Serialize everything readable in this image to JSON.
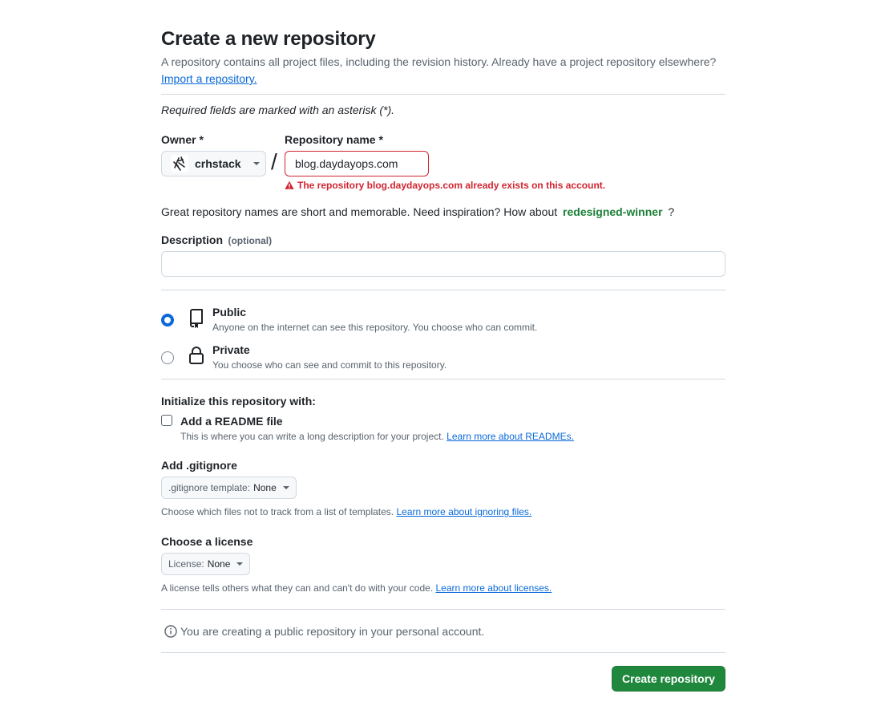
{
  "header": {
    "title": "Create a new repository",
    "desc_prefix": "A repository contains all project files, including the revision history. Already have a project repository elsewhere?",
    "import_link": "Import a repository."
  },
  "required_note": "Required fields are marked with an asterisk (*).",
  "owner": {
    "label": "Owner *",
    "value": "crhstack"
  },
  "separator": "/",
  "repo_name": {
    "label": "Repository name *",
    "value": "blog.daydayops.com",
    "error": "The repository blog.daydayops.com already exists on this account."
  },
  "suggestion": {
    "prefix": "Great repository names are short and memorable. Need inspiration? How about",
    "name": "redesigned-winner",
    "suffix": "?"
  },
  "description": {
    "label": "Description",
    "optional": "(optional)",
    "value": "",
    "placeholder": ""
  },
  "visibility": {
    "selected": "public",
    "public": {
      "label": "Public",
      "desc": "Anyone on the internet can see this repository. You choose who can commit."
    },
    "private": {
      "label": "Private",
      "desc": "You choose who can see and commit to this repository."
    }
  },
  "init": {
    "heading": "Initialize this repository with:",
    "readme_label": "Add a README file",
    "readme_checked": false,
    "readme_desc": "This is where you can write a long description for your project.",
    "readme_link": "Learn more about READMEs."
  },
  "gitignore": {
    "heading": "Add .gitignore",
    "button_prefix": ".gitignore template:",
    "button_value": "None",
    "desc": "Choose which files not to track from a list of templates.",
    "link": "Learn more about ignoring files."
  },
  "license": {
    "heading": "Choose a license",
    "button_prefix": "License:",
    "button_value": "None",
    "desc": "A license tells others what they can and can't do with your code.",
    "link": "Learn more about licenses."
  },
  "info_note": "You are creating a public repository in your personal account.",
  "submit": {
    "label": "Create repository"
  },
  "colors": {
    "accent": "#0969da",
    "danger": "#d1242f",
    "success": "#1a7f37",
    "primary_button": "#1f883d"
  }
}
